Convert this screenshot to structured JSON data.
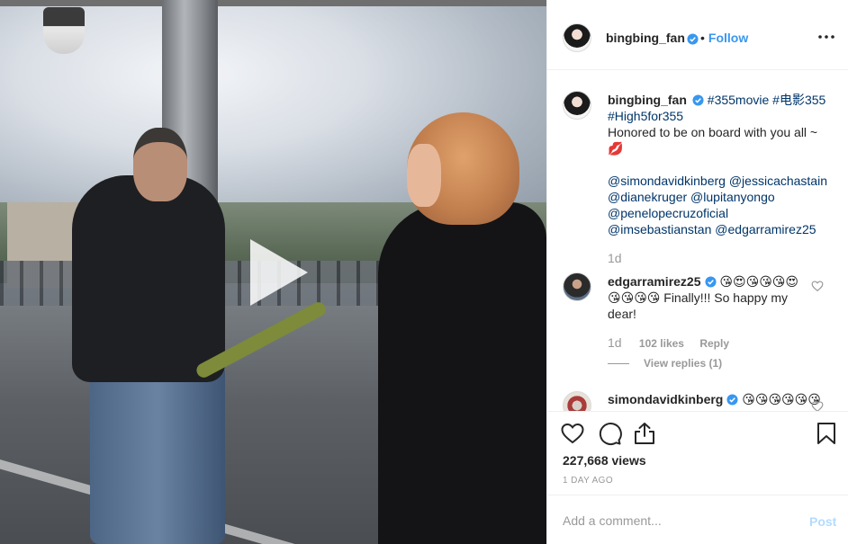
{
  "post": {
    "username": "bingbing_fan",
    "follow_label": "Follow",
    "follow_separator": "•",
    "caption_tags_line1": "#355movie #电影355",
    "caption_tags_line2": "#High5for355",
    "caption_body": "Honored to be on board with you all ~ 💋",
    "mentions": [
      "@simondavidkinberg",
      "@jessicachastain",
      "@dianekruger",
      "@lupitanyongo",
      "@penelopecruzoficial",
      "@imsebastianstan",
      "@edgarramirez25"
    ],
    "caption_time": "1d"
  },
  "comments": [
    {
      "username": "edgarramirez25",
      "text_line1": "😘😍😘😘😘😍",
      "text_line2": "😘😘😘😘 Finally!!! So happy my dear!",
      "time": "1d",
      "likes": "102 likes",
      "reply_label": "Reply",
      "view_replies": "View replies (1)"
    },
    {
      "username": "simondavidkinberg",
      "text": "😘😘😘😘😘😘"
    }
  ],
  "stats": {
    "views": "227,668 views",
    "ago": "1 DAY AGO"
  },
  "add_comment": {
    "placeholder": "Add a comment...",
    "post_label": "Post"
  },
  "icons": {
    "like": "heart-icon",
    "comment": "comment-icon",
    "share": "share-icon",
    "save": "bookmark-icon",
    "more": "more-options-icon",
    "play": "play-icon",
    "verified": "verified-badge-icon"
  },
  "colors": {
    "link": "#003569",
    "follow": "#3897f0",
    "verified": "#3897f0",
    "muted": "#999999",
    "post_disabled": "#b3dbff"
  }
}
